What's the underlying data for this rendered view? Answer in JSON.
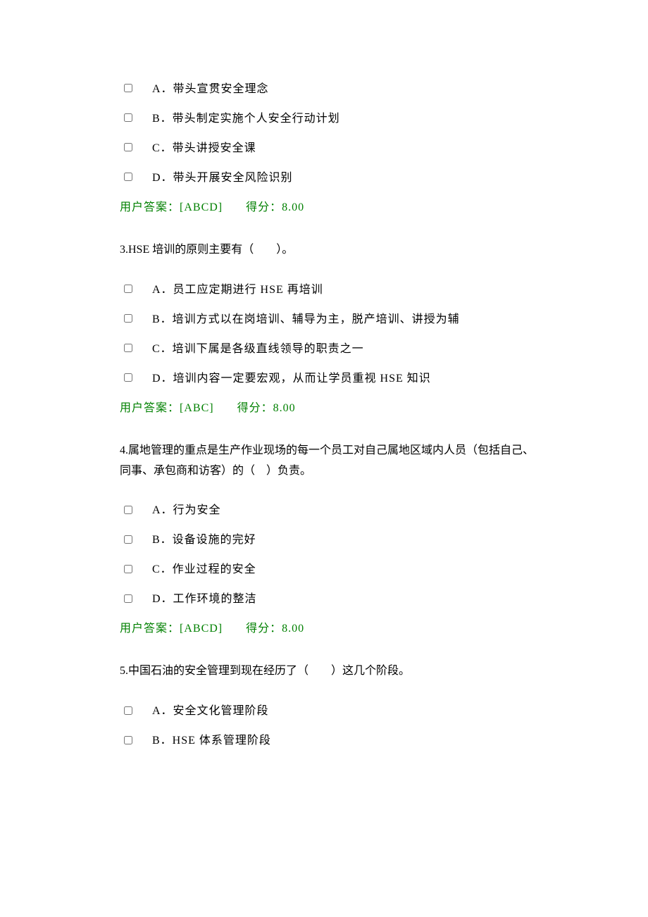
{
  "questions": [
    {
      "stem": "",
      "options": [
        {
          "label": "A．带头宣贯安全理念"
        },
        {
          "label": "B．带头制定实施个人安全行动计划"
        },
        {
          "label": "C．带头讲授安全课"
        },
        {
          "label": "D．带头开展安全风险识别"
        }
      ],
      "answer_prefix": "用户答案：",
      "answer_value": "[ABCD]",
      "score_prefix": "得分：",
      "score_value": "8.00"
    },
    {
      "stem": "3.HSE 培训的原则主要有（　　）。",
      "options": [
        {
          "label": "A．员工应定期进行 HSE 再培训"
        },
        {
          "label": "B．培训方式以在岗培训、辅导为主，脱产培训、讲授为辅"
        },
        {
          "label": "C．培训下属是各级直线领导的职责之一"
        },
        {
          "label": "D．培训内容一定要宏观，从而让学员重视 HSE 知识"
        }
      ],
      "answer_prefix": "用户答案：",
      "answer_value": "[ABC]",
      "score_prefix": "得分：",
      "score_value": "8.00"
    },
    {
      "stem": "4.属地管理的重点是生产作业现场的每一个员工对自己属地区域内人员（包括自己、同事、承包商和访客）的（　）负责。",
      "options": [
        {
          "label": "A．行为安全"
        },
        {
          "label": "B．设备设施的完好"
        },
        {
          "label": "C．作业过程的安全"
        },
        {
          "label": "D．工作环境的整洁"
        }
      ],
      "answer_prefix": "用户答案：",
      "answer_value": "[ABCD]",
      "score_prefix": "得分：",
      "score_value": "8.00"
    },
    {
      "stem": "5.中国石油的安全管理到现在经历了（　　）这几个阶段。",
      "options": [
        {
          "label": "A．安全文化管理阶段"
        },
        {
          "label": "B．HSE 体系管理阶段"
        }
      ],
      "answer_prefix": "",
      "answer_value": "",
      "score_prefix": "",
      "score_value": ""
    }
  ]
}
